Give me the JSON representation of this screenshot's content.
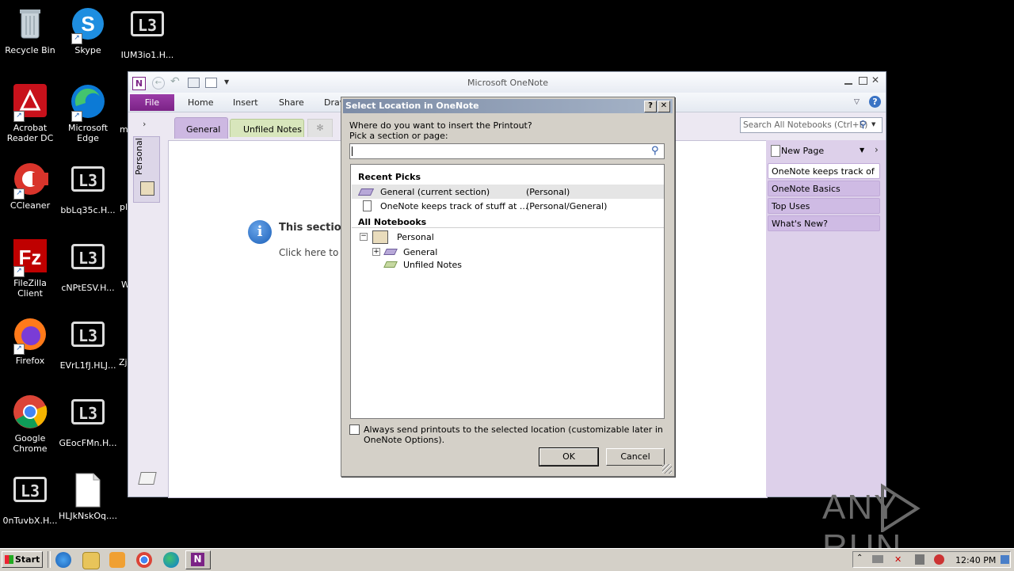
{
  "desktop": {
    "icons": [
      {
        "label": "Recycle Bin"
      },
      {
        "label": "Skype"
      },
      {
        "label": "IUM3io1.H..."
      },
      {
        "label": "Acrobat Reader DC"
      },
      {
        "label": "Microsoft Edge"
      },
      {
        "label": "m"
      },
      {
        "label": "CCleaner"
      },
      {
        "label": "bbLq35c.H..."
      },
      {
        "label": "pl"
      },
      {
        "label": "FileZilla Client"
      },
      {
        "label": "cNPtESV.H..."
      },
      {
        "label": "W"
      },
      {
        "label": "Firefox"
      },
      {
        "label": "EVrL1fJ.HLJ..."
      },
      {
        "label": "Zj"
      },
      {
        "label": "Google Chrome"
      },
      {
        "label": "GEocFMn.H..."
      },
      {
        "label": "0nTuvbX.H..."
      },
      {
        "label": "HLJkNskOq...."
      }
    ]
  },
  "onenote": {
    "title": "Microsoft OneNote",
    "ribbon_tabs": [
      "File",
      "Home",
      "Insert",
      "Share",
      "Drav"
    ],
    "section_tabs": [
      "General",
      "Unfiled Notes"
    ],
    "notebook_label": "Personal",
    "search_placeholder": "Search All Notebooks (Ctrl+E)",
    "info_title": "This section",
    "info_sub": "Click here to c",
    "new_page": "New Page",
    "pages": [
      "OneNote keeps track of st",
      "OneNote Basics",
      "Top Uses",
      "What's New?"
    ]
  },
  "dialog": {
    "title": "Select Location in OneNote",
    "prompt1": "Where do you want to insert the Printout?",
    "prompt2": "Pick a section or page:",
    "search_value": "",
    "recent_header": "Recent Picks",
    "recent": [
      {
        "name": "General (current section)",
        "loc": "(Personal)"
      },
      {
        "name": "OneNote keeps track of stuff at ...",
        "loc": "(Personal/General)"
      }
    ],
    "all_header": "All Notebooks",
    "tree": {
      "notebook": "Personal",
      "sections": [
        "General",
        "Unfiled Notes"
      ]
    },
    "checkbox_label": "Always send printouts to the selected location (customizable later in OneNote Options).",
    "checkbox_checked": false,
    "ok": "OK",
    "cancel": "Cancel",
    "help_btn": "?",
    "close_btn": "✕"
  },
  "taskbar": {
    "start": "Start",
    "clock": "12:40 PM"
  },
  "watermark": "ANY RUN"
}
